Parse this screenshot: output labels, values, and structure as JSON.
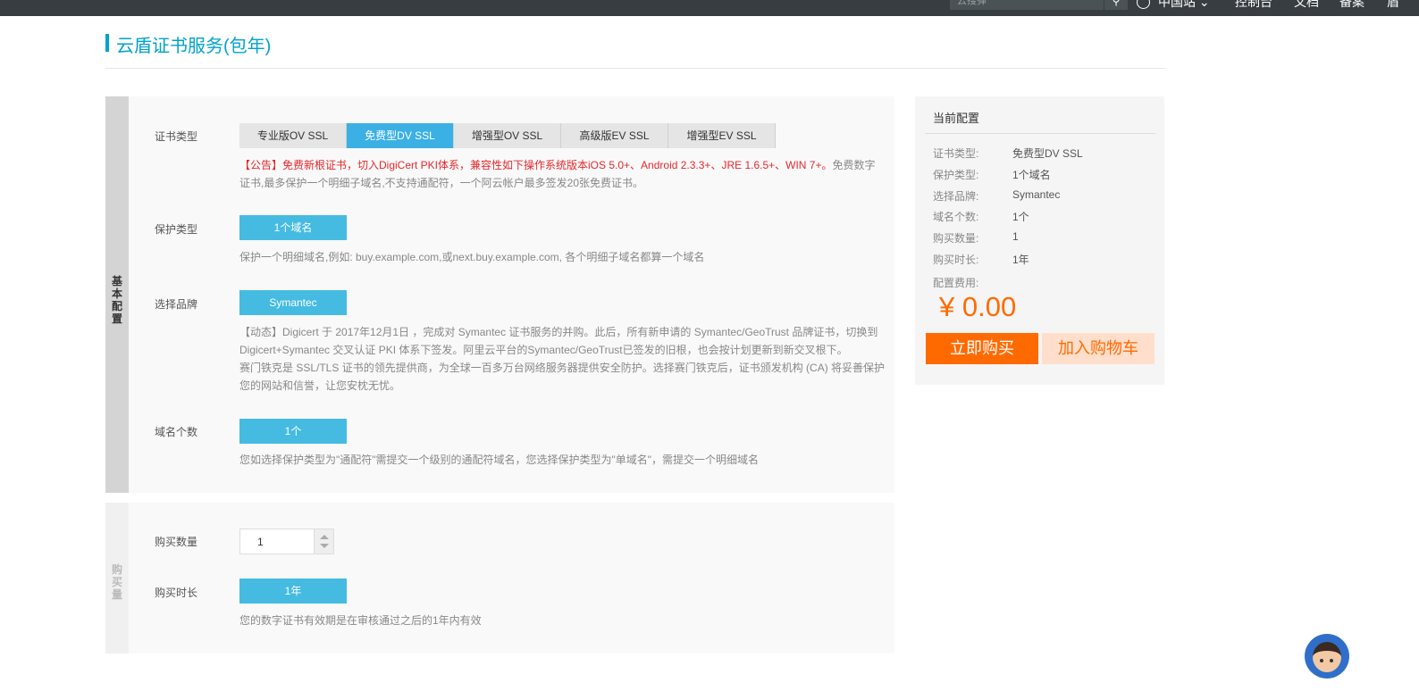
{
  "topbar": {
    "search_placeholder": "云搜弹",
    "search_icon": "search-icon",
    "region": "中国站",
    "links": [
      "控制台",
      "文档",
      "备案",
      "盾"
    ]
  },
  "page": {
    "title": "云盾证书服务(包年)"
  },
  "basic": {
    "section_label": "基本配置",
    "cert_type": {
      "label": "证书类型",
      "options": [
        "专业版OV SSL",
        "免费型DV SSL",
        "增强型OV SSL",
        "高级版EV SSL",
        "增强型EV SSL"
      ],
      "selected": "免费型DV SSL",
      "notice_red": "【公告】免费新根证书，切入DigiCert PKI体系，兼容性如下操作系统版本iOS 5.0+、Android 2.3.3+、JRE 1.6.5+、WIN 7+。",
      "notice_gray": "免费数字证书,最多保护一个明细子域名,不支持通配符，一个阿云帐户最多签发20张免费证书。"
    },
    "protect_type": {
      "label": "保护类型",
      "value": "1个域名",
      "desc": "保护一个明细域名,例如: buy.example.com,或next.buy.example.com, 各个明细子域名都算一个域名"
    },
    "brand": {
      "label": "选择品牌",
      "value": "Symantec",
      "desc1": "【动态】Digicert 于 2017年12月1日 ，完成对 Symantec 证书服务的并购。此后，所有新申请的 Symantec/GeoTrust 品牌证书，切换到",
      "desc2": "Digicert+Symantec 交叉认证 PKI 体系下签发。阿里云平台的Symantec/GeoTrust已签发的旧根，也会按计划更新到新交叉根下。",
      "desc3": "赛门铁克是 SSL/TLS 证书的领先提供商，为全球一百多万台网络服务器提供安全防护。选择赛门铁克后，证书颁发机构 (CA) 将妥善保护",
      "desc4": "您的网站和信誉，让您安枕无忧。"
    },
    "domain_count": {
      "label": "域名个数",
      "value": "1个",
      "desc": "您如选择保护类型为\"通配符\"需提交一个级别的通配符域名，您选择保护类型为\"单域名\"，需提交一个明细域名"
    }
  },
  "purchase": {
    "section_label": "购买量",
    "quantity": {
      "label": "购买数量",
      "value": "1"
    },
    "duration": {
      "label": "购买时长",
      "value": "1年",
      "desc": "您的数字证书有效期是在审核通过之后的1年内有效"
    }
  },
  "summary": {
    "title": "当前配置",
    "rows": [
      {
        "k": "证书类型:",
        "v": "免费型DV SSL"
      },
      {
        "k": "保护类型:",
        "v": "1个域名"
      },
      {
        "k": "选择品牌:",
        "v": "Symantec"
      },
      {
        "k": "域名个数:",
        "v": "1个"
      },
      {
        "k": "购买数量:",
        "v": "1"
      },
      {
        "k": "购买时长:",
        "v": "1年"
      }
    ],
    "fee_label": "配置费用:",
    "price": "¥ 0.00",
    "buy_now": "立即购买",
    "add_cart": "加入购物车"
  },
  "colors": {
    "accent": "#00a2ca",
    "chip": "#45bbe2",
    "orange": "#ff6a00",
    "red_notice": "#e4282c"
  }
}
